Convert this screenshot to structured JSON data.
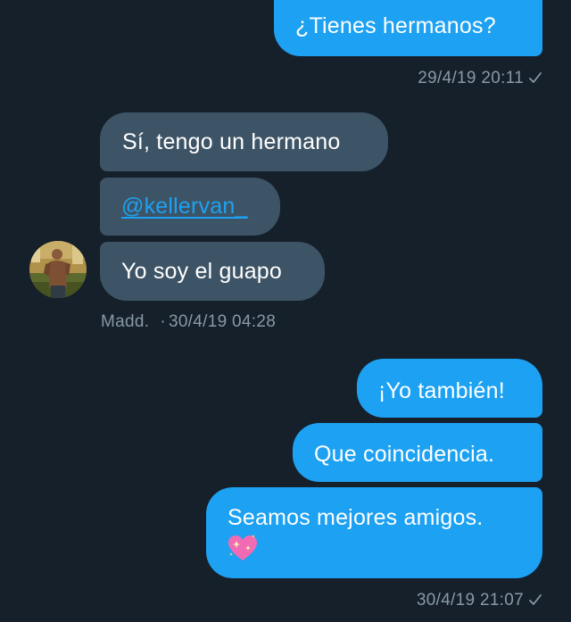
{
  "conversation": {
    "msg1": {
      "text": "¿Tienes hermanos?",
      "meta": "29/4/19 20:11"
    },
    "msg2": {
      "text": "Sí, tengo un hermano"
    },
    "msg3": {
      "text": "@kellervan_"
    },
    "msg4": {
      "text": "Yo soy el guapo"
    },
    "msg4_meta": {
      "sender": "Madd.",
      "time": "30/4/19 04:28"
    },
    "msg5": {
      "text": "¡Yo también!"
    },
    "msg6": {
      "text": "Que coincidencia."
    },
    "msg7": {
      "text": "Seamos mejores amigos.",
      "emoji": "sparkling-heart-icon"
    },
    "msg7_meta": {
      "time": "30/4/19 21:07"
    }
  },
  "colors": {
    "background": "#15202b",
    "outgoing_bubble": "#1da1f2",
    "incoming_bubble": "#3d5466",
    "meta_text": "#8899a6",
    "link": "#1da1f2"
  }
}
